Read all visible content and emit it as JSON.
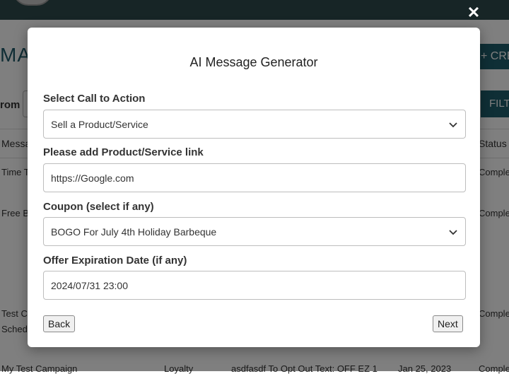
{
  "background": {
    "page_title": "MA",
    "create_button": "+ CRE",
    "from_label": "rom",
    "filter_button": "FILT",
    "table_headers": [
      "Messa",
      "Status"
    ],
    "rows": [
      {
        "message": "Time T",
        "status": "Comple"
      },
      {
        "message": "Free B",
        "status": "Comple"
      },
      {
        "message": "Test C",
        "message2": "Sched",
        "status": "Comple"
      },
      {
        "message": "My Test Campaign",
        "type": "Loyalty",
        "detail": "asdfasdf To Opt Out Text: OFF EZ 1",
        "date": "Jan 25, 2023",
        "status": "Comple"
      }
    ]
  },
  "modal": {
    "title": "AI Message Generator",
    "close_symbol": "✕",
    "fields": [
      {
        "label": "Select Call to Action",
        "value": "Sell a Product/Service"
      },
      {
        "label": "Please add Product/Service link",
        "value": "https://Google.com"
      },
      {
        "label": "Coupon (select if any)",
        "value": "BOGO For July 4th Holiday Barbeque"
      },
      {
        "label": "Offer Expiration Date (if any)",
        "value": "2024/07/31 23:00"
      }
    ],
    "back_button": "Back",
    "next_button": "Next"
  }
}
